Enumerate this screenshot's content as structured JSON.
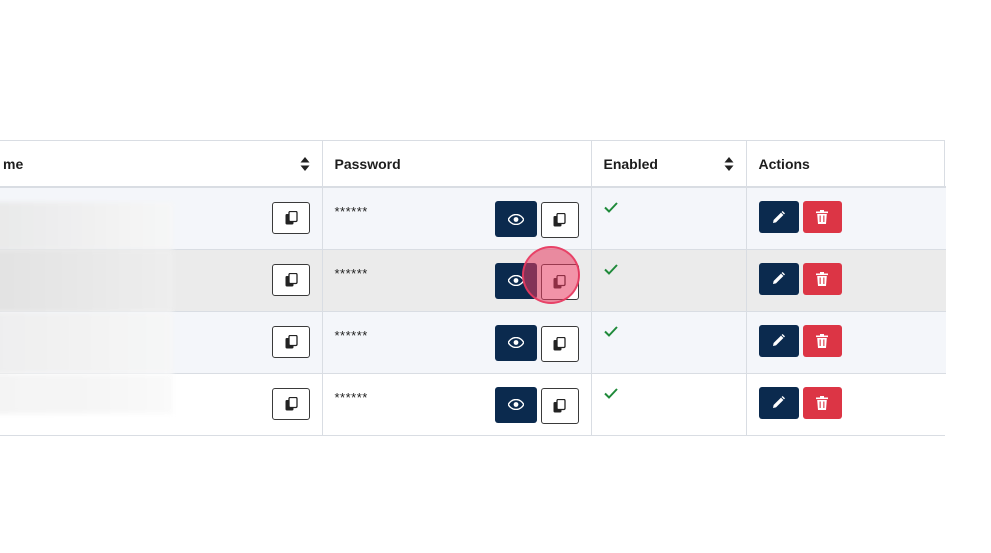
{
  "table": {
    "headers": {
      "name": "me",
      "password": "Password",
      "enabled": "Enabled",
      "actions": "Actions"
    },
    "rows": [
      {
        "password_masked": "******",
        "enabled": true
      },
      {
        "password_masked": "******",
        "enabled": true
      },
      {
        "password_masked": "******",
        "enabled": true
      },
      {
        "password_masked": "******",
        "enabled": true
      }
    ]
  },
  "icons": {
    "copy": "copy-icon",
    "view": "eye-icon",
    "edit": "pencil-icon",
    "delete": "trash-icon",
    "sort": "sort-icon",
    "check": "check-icon"
  },
  "colors": {
    "navy": "#0b2a4e",
    "danger": "#dc3545",
    "success": "#1f8a3a"
  }
}
